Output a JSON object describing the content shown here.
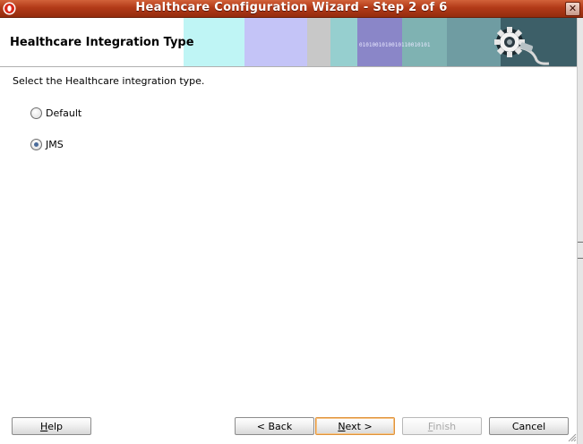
{
  "window": {
    "title": "Healthcare Configuration Wizard - Step 2 of 6",
    "close_label": "✕"
  },
  "header": {
    "title": "Healthcare Integration Type",
    "banner_text": "0101001010010110010101"
  },
  "content": {
    "instruction": "Select the Healthcare integration type.",
    "options": [
      {
        "label": "Default",
        "selected": false
      },
      {
        "label": "JMS",
        "selected": true
      }
    ]
  },
  "buttons": {
    "help": "Help",
    "back": "< Back",
    "next": "Next >",
    "finish": "Finish",
    "cancel": "Cancel"
  },
  "colors": {
    "titlebar": "#b23a18",
    "focus_border": "#e0923a",
    "radio_dot": "#4a6b9a"
  }
}
